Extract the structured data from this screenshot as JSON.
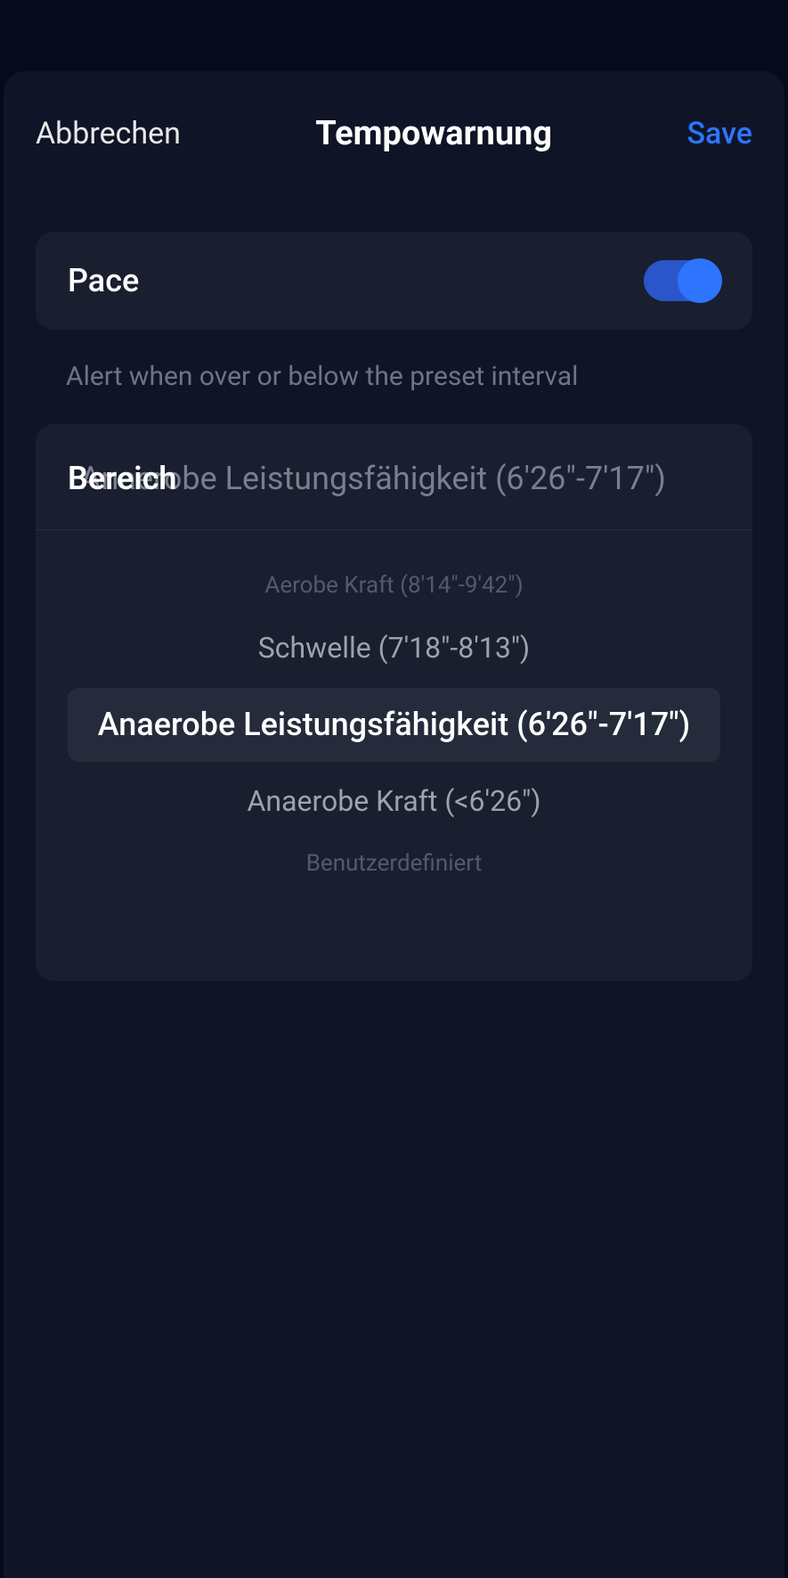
{
  "header": {
    "cancel": "Abbrechen",
    "title": "Tempowarnung",
    "save": "Save"
  },
  "pace": {
    "label": "Pace",
    "enabled": true
  },
  "description": "Alert when over or below the preset interval",
  "range": {
    "label": "Bereich",
    "selected_display": "Anaerobe Leistungsfähigkeit (6'26\"-7'17\")",
    "options": [
      "Aerobe Kraft (8'14\"-9'42\")",
      "Schwelle (7'18\"-8'13\")",
      "Anaerobe Leistungsfähigkeit (6'26\"-7'17\")",
      "Anaerobe Kraft (<6'26\")",
      "Benutzerdefiniert"
    ]
  }
}
